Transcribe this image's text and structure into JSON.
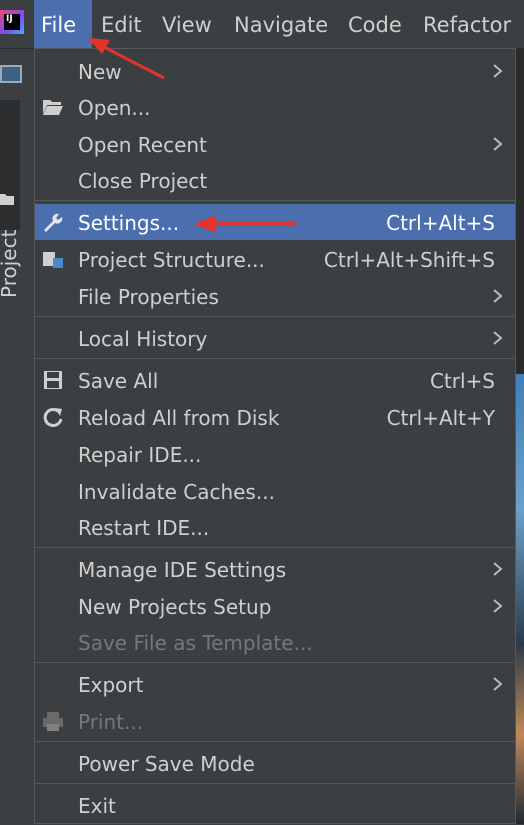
{
  "menubar": {
    "items": [
      {
        "label": "File",
        "active": true
      },
      {
        "label": "Edit"
      },
      {
        "label": "View"
      },
      {
        "label": "Navigate"
      },
      {
        "label": "Code"
      },
      {
        "label": "Refactor"
      }
    ]
  },
  "sidebar": {
    "project_label": "Project"
  },
  "file_menu": {
    "new": "New",
    "open": "Open...",
    "open_recent": "Open Recent",
    "close_project": "Close Project",
    "settings": "Settings...",
    "settings_shortcut": "Ctrl+Alt+S",
    "project_structure": "Project Structure...",
    "project_structure_shortcut": "Ctrl+Alt+Shift+S",
    "file_properties": "File Properties",
    "local_history": "Local History",
    "save_all": "Save All",
    "save_all_shortcut": "Ctrl+S",
    "reload": "Reload All from Disk",
    "reload_shortcut": "Ctrl+Alt+Y",
    "repair": "Repair IDE...",
    "invalidate": "Invalidate Caches...",
    "restart": "Restart IDE...",
    "manage_settings": "Manage IDE Settings",
    "new_projects_setup": "New Projects Setup",
    "save_template": "Save File as Template...",
    "export": "Export",
    "print": "Print...",
    "power_save": "Power Save Mode",
    "exit": "Exit"
  },
  "colors": {
    "menu_bg": "#3c3f41",
    "highlight": "#4b6eaf",
    "annotation_arrow": "#e5322d"
  }
}
